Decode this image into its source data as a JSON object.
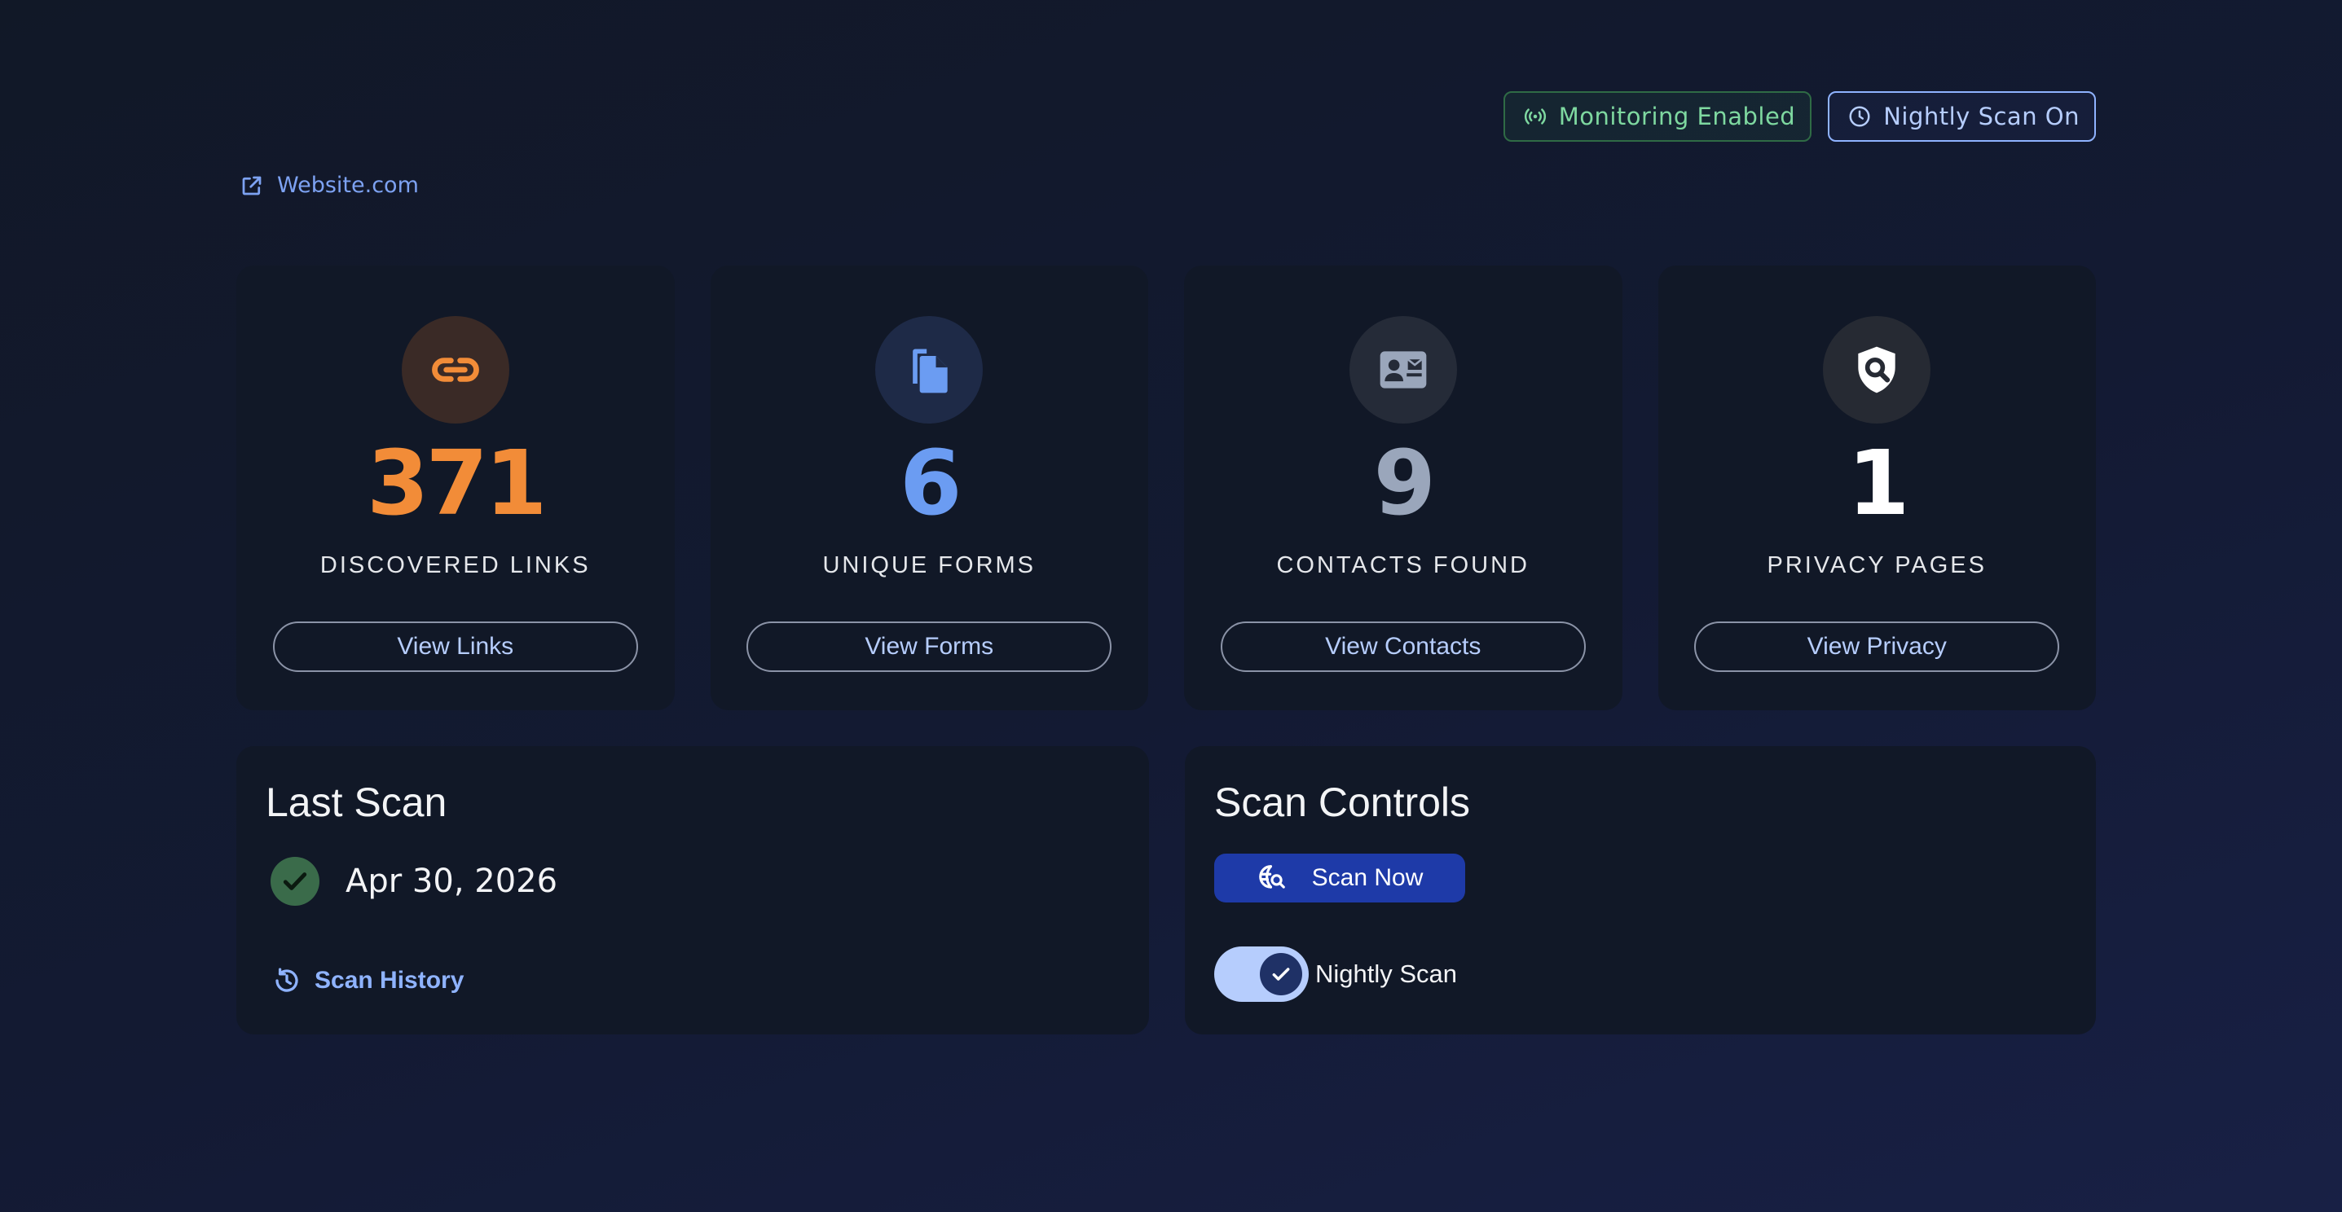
{
  "header": {
    "badges": [
      {
        "label": "Monitoring Enabled",
        "icon": "broadcast-icon",
        "color": "#7ed8a0"
      },
      {
        "label": "Nightly Scan On",
        "icon": "clock-icon",
        "color": "#b6cdfd"
      }
    ],
    "site_link": {
      "label": "Website.com",
      "icon": "external-link-icon"
    }
  },
  "metrics": [
    {
      "value": "371",
      "label": "DISCOVERED LINKS",
      "button": "View Links",
      "icon": "link-icon",
      "color": "#f28c38"
    },
    {
      "value": "6",
      "label": "UNIQUE FORMS",
      "button": "View Forms",
      "icon": "documents-icon",
      "color": "#6b9cf2"
    },
    {
      "value": "9",
      "label": "CONTACTS FOUND",
      "button": "View Contacts",
      "icon": "contact-card-icon",
      "color": "#9aa6bb"
    },
    {
      "value": "1",
      "label": "PRIVACY PAGES",
      "button": "View Privacy",
      "icon": "shield-search-icon",
      "color": "#ffffff"
    }
  ],
  "last_scan": {
    "title": "Last Scan",
    "date": "Apr 30, 2026",
    "status_icon": "check-icon",
    "history_label": "Scan History"
  },
  "scan_controls": {
    "title": "Scan Controls",
    "scan_now_label": "Scan Now",
    "nightly_scan_label": "Nightly Scan",
    "nightly_scan_enabled": true
  }
}
